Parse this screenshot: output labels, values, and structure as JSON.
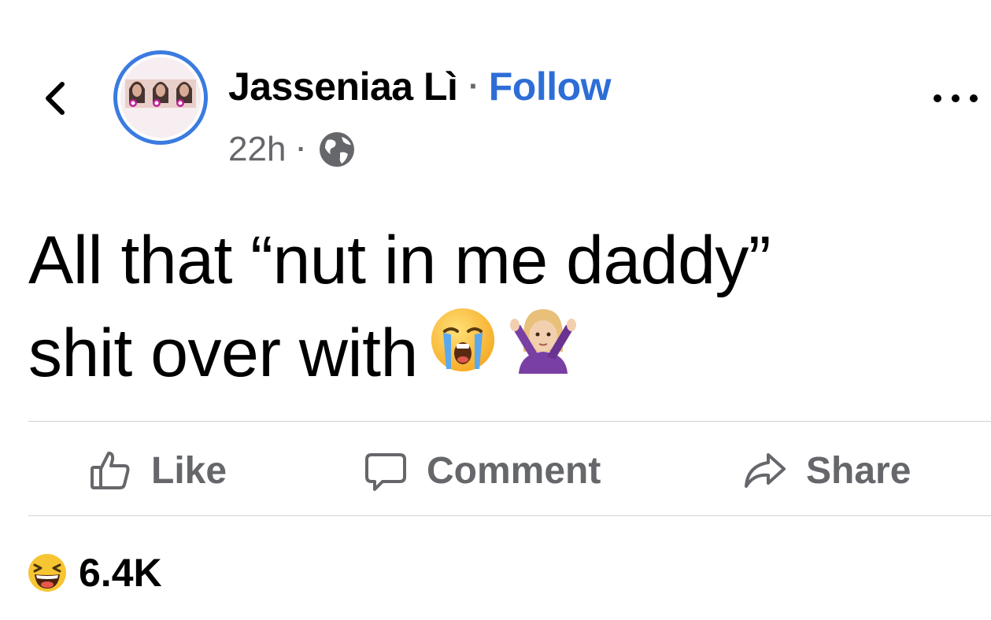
{
  "header": {
    "back_icon": "chevron-left-icon",
    "author_name": "Jasseniaa Lì",
    "separator": "·",
    "follow_label": "Follow",
    "timestamp": "22h",
    "meta_separator": "·",
    "privacy_icon": "globe-icon",
    "more_icon": "more-horizontal-icon"
  },
  "post": {
    "line1": "All that “nut in me daddy”",
    "line2": "shit over with",
    "emojis": [
      "loudly-crying-face-emoji",
      "woman-gesturing-no-emoji"
    ]
  },
  "actions": {
    "like_label": "Like",
    "comment_label": "Comment",
    "share_label": "Share"
  },
  "reactions": {
    "icon": "laughing-face-emoji",
    "count": "6.4K"
  },
  "colors": {
    "accent": "#2d6ed6",
    "avatar_ring": "#3b7be0",
    "secondary_text": "#65676b",
    "divider": "#cfd1d5"
  }
}
